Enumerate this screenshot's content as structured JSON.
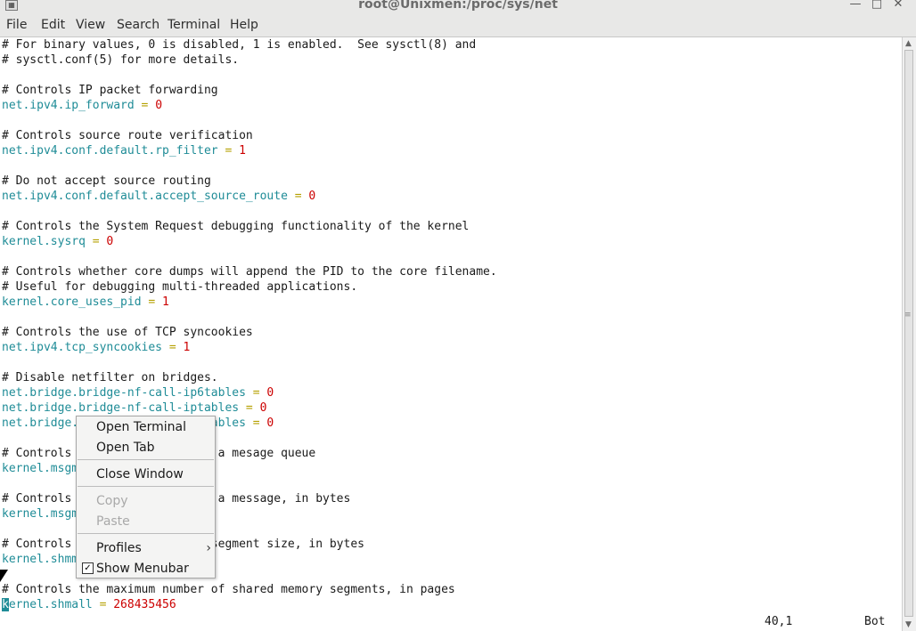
{
  "window": {
    "title": "root@Unixmen:/proc/sys/net",
    "icon": "terminal-window-icon",
    "controls": [
      "minimize-icon",
      "maximize-icon",
      "close-icon"
    ]
  },
  "menubar": {
    "items": [
      "File",
      "Edit",
      "View",
      "Search",
      "Terminal",
      "Help"
    ]
  },
  "editor": {
    "lines": [
      {
        "c": "# For binary values, 0 is disabled, 1 is enabled.  See sysctl(8) and"
      },
      {
        "c": "# sysctl.conf(5) for more details."
      },
      {
        "c": ""
      },
      {
        "c": "# Controls IP packet forwarding"
      },
      {
        "k": "net.ipv4.ip_forward",
        "v": "0"
      },
      {
        "c": ""
      },
      {
        "c": "# Controls source route verification"
      },
      {
        "k": "net.ipv4.conf.default.rp_filter",
        "v": "1"
      },
      {
        "c": ""
      },
      {
        "c": "# Do not accept source routing"
      },
      {
        "k": "net.ipv4.conf.default.accept_source_route",
        "v": "0"
      },
      {
        "c": ""
      },
      {
        "c": "# Controls the System Request debugging functionality of the kernel"
      },
      {
        "k": "kernel.sysrq",
        "v": "0"
      },
      {
        "c": ""
      },
      {
        "c": "# Controls whether core dumps will append the PID to the core filename."
      },
      {
        "c": "# Useful for debugging multi-threaded applications."
      },
      {
        "k": "kernel.core_uses_pid",
        "v": "1"
      },
      {
        "c": ""
      },
      {
        "c": "# Controls the use of TCP syncookies"
      },
      {
        "k": "net.ipv4.tcp_syncookies",
        "v": "1"
      },
      {
        "c": ""
      },
      {
        "c": "# Disable netfilter on bridges."
      },
      {
        "k": "net.bridge.bridge-nf-call-ip6tables",
        "v": "0"
      },
      {
        "k": "net.bridge.bridge-nf-call-iptables",
        "v": "0"
      },
      {
        "k": "net.bridge.bridge-nf-call-arptables",
        "v": "0"
      },
      {
        "c": ""
      },
      {
        "c": "# Controls the maximum size of a mesage queue"
      },
      {
        "k": "kernel.msgmnb",
        "v": ""
      },
      {
        "c": ""
      },
      {
        "c": "# Controls the maximum size of a message, in bytes"
      },
      {
        "k": "kernel.msgmax",
        "v": ""
      },
      {
        "c": ""
      },
      {
        "c": "# Controls the maximum shared segment size, in bytes"
      },
      {
        "k": "kernel.shmmax",
        "v": ""
      },
      {
        "c": ""
      },
      {
        "c": "# Controls the maximum number of shared memory segments, in pages"
      },
      {
        "k": "kernel.shmall",
        "v": "268435456",
        "cursor": true
      }
    ],
    "status": {
      "position": "40,1",
      "scroll": "Bot"
    }
  },
  "context_menu": {
    "open_terminal": "Open Terminal",
    "open_tab": "Open Tab",
    "close_window": "Close Window",
    "copy": "Copy",
    "paste": "Paste",
    "profiles": "Profiles",
    "show_menubar": "Show Menubar",
    "show_menubar_checked": true
  },
  "colors": {
    "key": "#1f8c97",
    "equals": "#b5a000",
    "number": "#cc0000"
  }
}
